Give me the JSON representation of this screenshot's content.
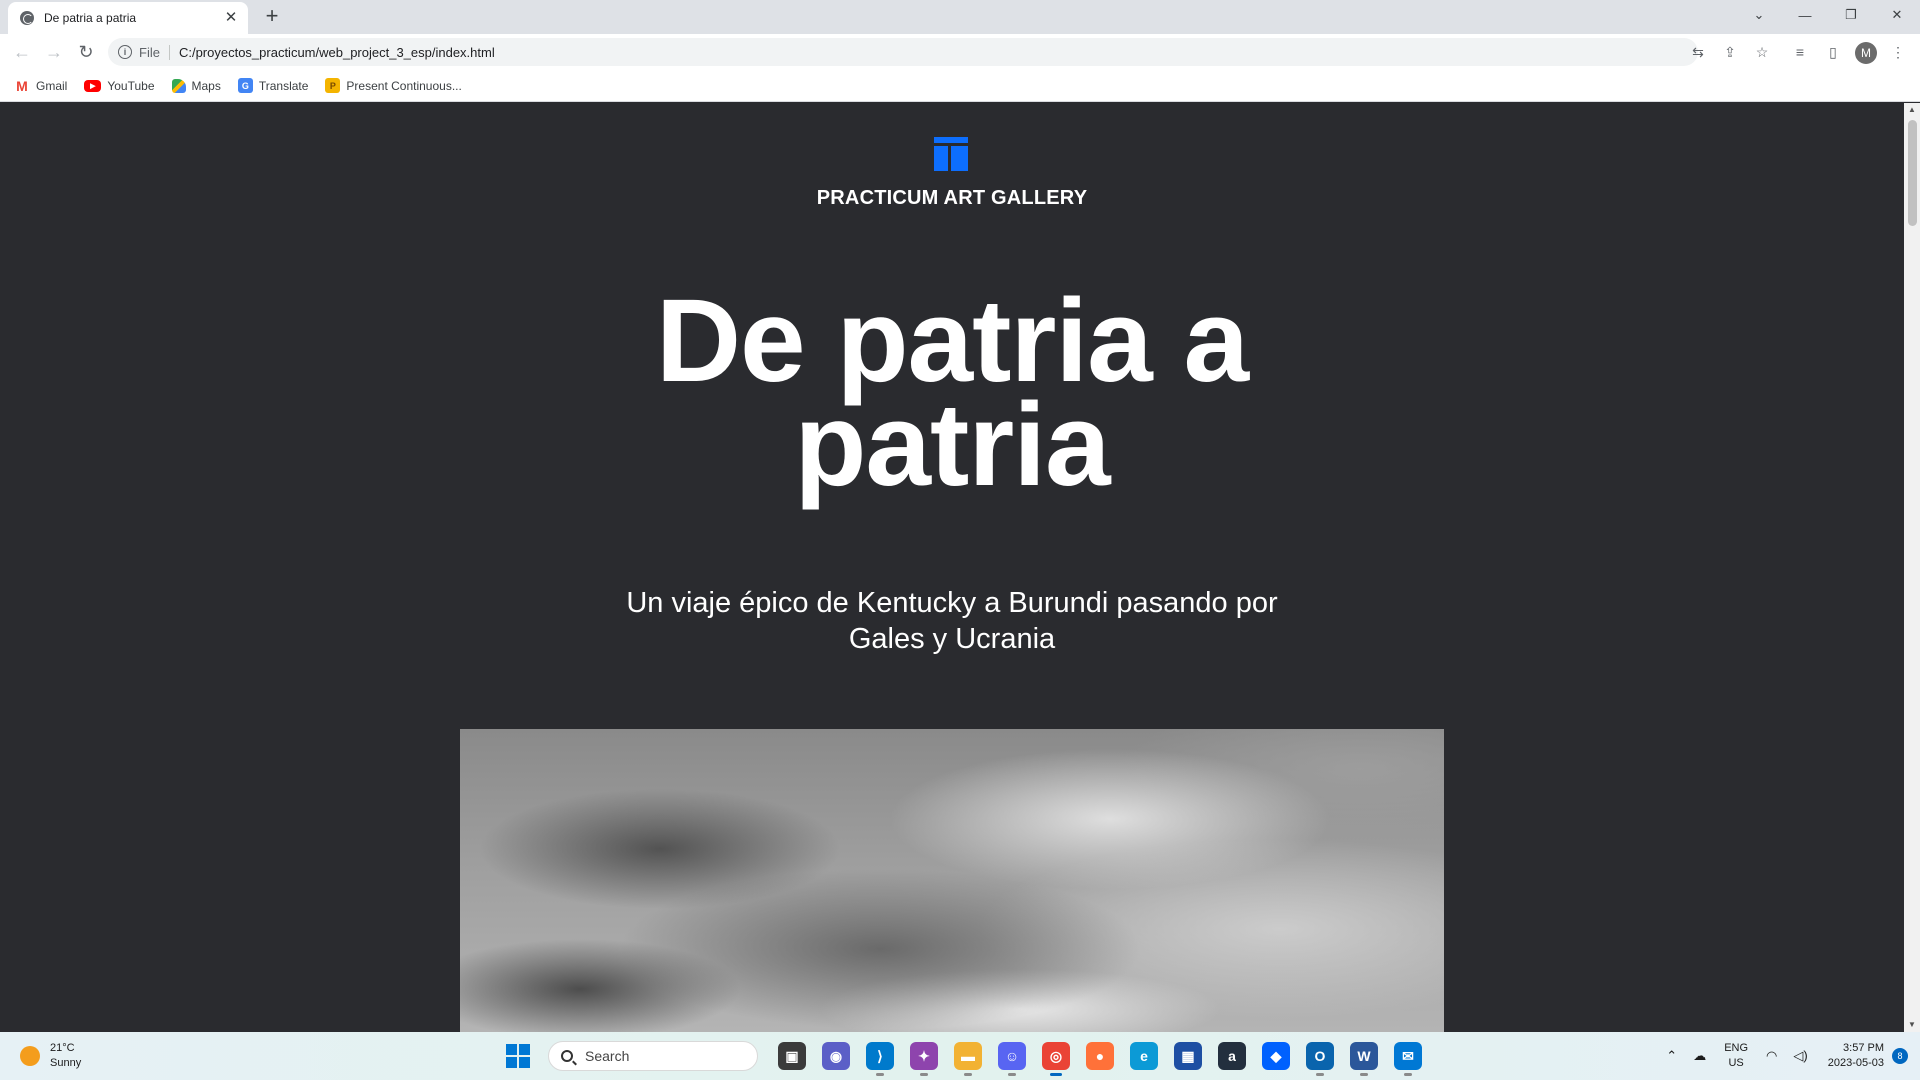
{
  "browser": {
    "tab": {
      "title": "De patria a patria",
      "close": "✕"
    },
    "new_tab": "+",
    "window_controls": {
      "list": "⌄",
      "minimize": "—",
      "restore": "❐",
      "close": "✕"
    },
    "toolbar": {
      "back": "←",
      "forward": "→",
      "reload": "↻",
      "scheme_label": "File",
      "url": "C:/proyectos_practicum/web_project_3_esp/index.html",
      "avatar_letter": "M"
    },
    "bookmarks": [
      {
        "label": "Gmail",
        "icon": "gmail-icon"
      },
      {
        "label": "YouTube",
        "icon": "youtube-icon"
      },
      {
        "label": "Maps",
        "icon": "maps-icon"
      },
      {
        "label": "Translate",
        "icon": "translate-icon"
      },
      {
        "label": "Present Continuous...",
        "icon": "bookmark-page-icon"
      }
    ]
  },
  "page": {
    "brand": "PRACTICUM ART GALLERY",
    "hero_title": "De patria a patria",
    "hero_subtitle": "Un viaje épico de Kentucky a Burundi pasando por Gales y Ucrania",
    "logo_color": "#0d6efd"
  },
  "taskbar": {
    "weather": {
      "temp": "21°C",
      "condition": "Sunny"
    },
    "search_label": "Search",
    "tray": {
      "lang": "ENG",
      "region": "US",
      "time": "3:57 PM",
      "date": "2023-05-03",
      "notifications": "8"
    }
  },
  "colors": {
    "page_background": "#2a2b2f",
    "accent": "#0d6efd",
    "text": "#ffffff"
  }
}
